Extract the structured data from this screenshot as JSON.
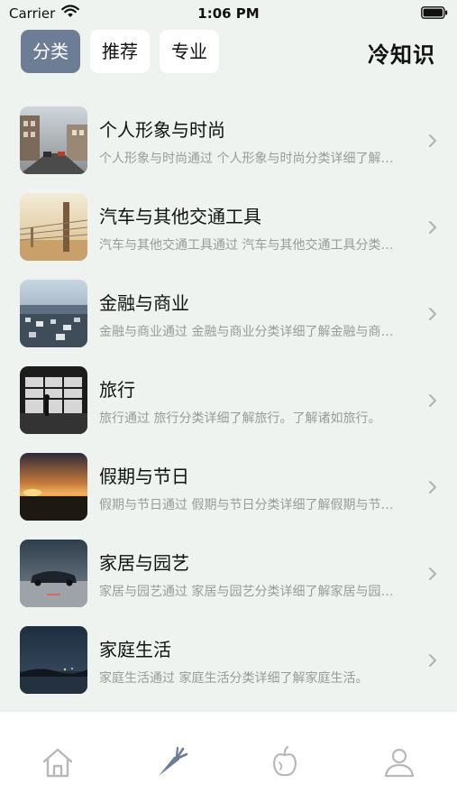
{
  "status_bar": {
    "carrier": "Carrier",
    "time": "1:06 PM"
  },
  "header": {
    "tabs": [
      {
        "label": "分类",
        "active": true
      },
      {
        "label": "推荐",
        "active": false
      },
      {
        "label": "专业",
        "active": false
      }
    ],
    "title": "冷知识"
  },
  "colors": {
    "background": "#eef3ef",
    "active_tab": "#6e7d96",
    "active_tabbar_icon": "#6e7d96",
    "inactive_tabbar_icon": "#b8b8b8"
  },
  "categories": [
    {
      "title": "个人形象与时尚",
      "description": "个人形象与时尚通过 个人形象与时尚分类详细了解个人形象与时尚。",
      "thumbnail": "city-street"
    },
    {
      "title": "汽车与其他交通工具",
      "description": "汽车与其他交通工具通过 汽车与其他交通工具分类详细了解汽车与其他交通工具。",
      "thumbnail": "fence-post"
    },
    {
      "title": "金融与商业",
      "description": "金融与商业通过 金融与商业分类详细了解金融与商业。",
      "thumbnail": "city-aerial"
    },
    {
      "title": "旅行",
      "description": "旅行通过 旅行分类详细了解旅行。了解诸如旅行。",
      "thumbnail": "airport-silhouette"
    },
    {
      "title": "假期与节日",
      "description": "假期与节日通过 假期与节日分类详细了解假期与节日。",
      "thumbnail": "sunset-lake"
    },
    {
      "title": "家居与园艺",
      "description": "家居与园艺通过 家居与园艺分类详细了解家居与园艺。",
      "thumbnail": "night-car"
    },
    {
      "title": "家庭生活",
      "description": "家庭生活通过 家庭生活分类详细了解家庭生活。",
      "thumbnail": "night-shore"
    }
  ],
  "tabbar": [
    {
      "icon": "home-icon",
      "active": false
    },
    {
      "icon": "carrot-icon",
      "active": true
    },
    {
      "icon": "fruit-icon",
      "active": false
    },
    {
      "icon": "profile-icon",
      "active": false
    }
  ]
}
